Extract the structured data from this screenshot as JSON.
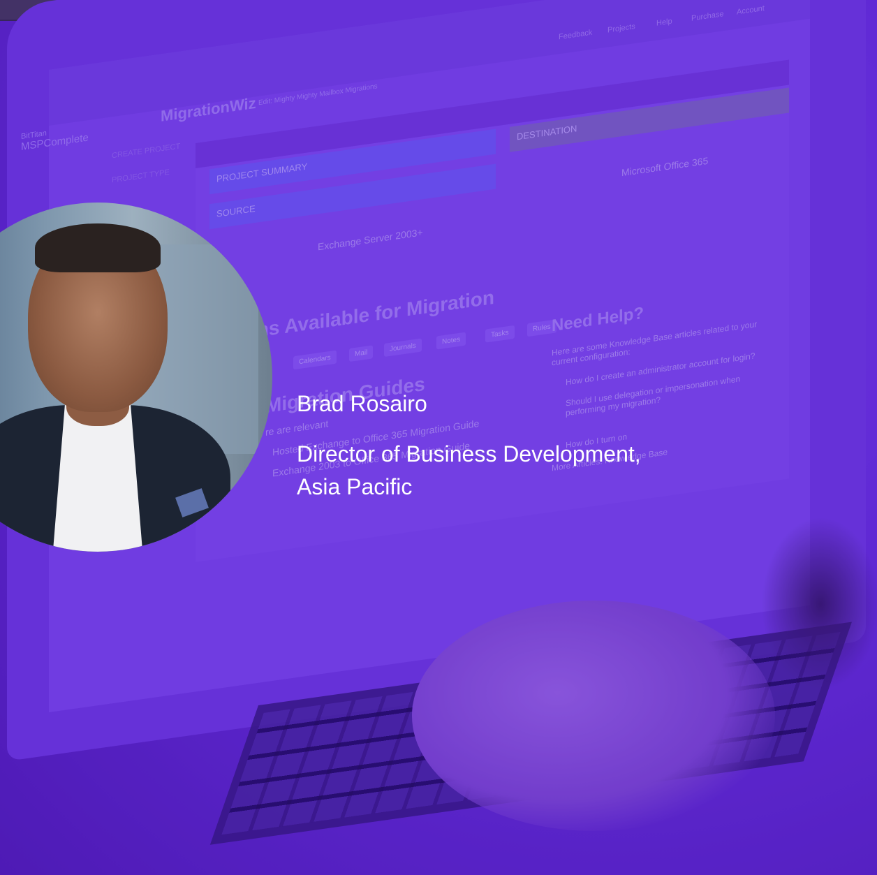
{
  "screen_ui": {
    "nav": [
      "Feedback",
      "Projects",
      "Help",
      "Purchase",
      "Account"
    ],
    "brand": {
      "line1": "BitTitan",
      "line2": "MSPComplete",
      "product": "MigrationWiz",
      "edit": "Edit: Mighty Mighty Mailbox Migrations"
    },
    "sidebar": [
      "CREATE PROJECT",
      "PROJECT TYPE"
    ],
    "panel": {
      "summary": "PROJECT SUMMARY",
      "source_label": "SOURCE",
      "source_value": "Exchange Server 2003+",
      "destination_label": "DESTINATION",
      "destination_value": "Microsoft Office 365",
      "items_heading": "ms Available for Migration",
      "chips": [
        "Calendars",
        "Mail",
        "Journals",
        "Notes",
        "Tasks",
        "Rules"
      ],
      "guides_heading": "Migration Guides",
      "guides_sub": "re are relevant",
      "guides": [
        "Hosted Exchange to Office 365 Migration Guide",
        "Exchange 2003 to Office 365 Migration Guide"
      ],
      "help_heading": "Need Help?",
      "help_intro": "Here are some Knowledge Base articles related to your current configuration:",
      "help_items": [
        "How do I create an administrator account for login?",
        "Should I use delegation or impersonation when performing my migration?",
        "How do I turn on"
      ],
      "more_articles": "More Articles: Knowledge Base"
    }
  },
  "person": {
    "name": "Brad Rosairo",
    "title_line1": "Director of Business Development,",
    "title_line2": "Asia Pacific"
  }
}
